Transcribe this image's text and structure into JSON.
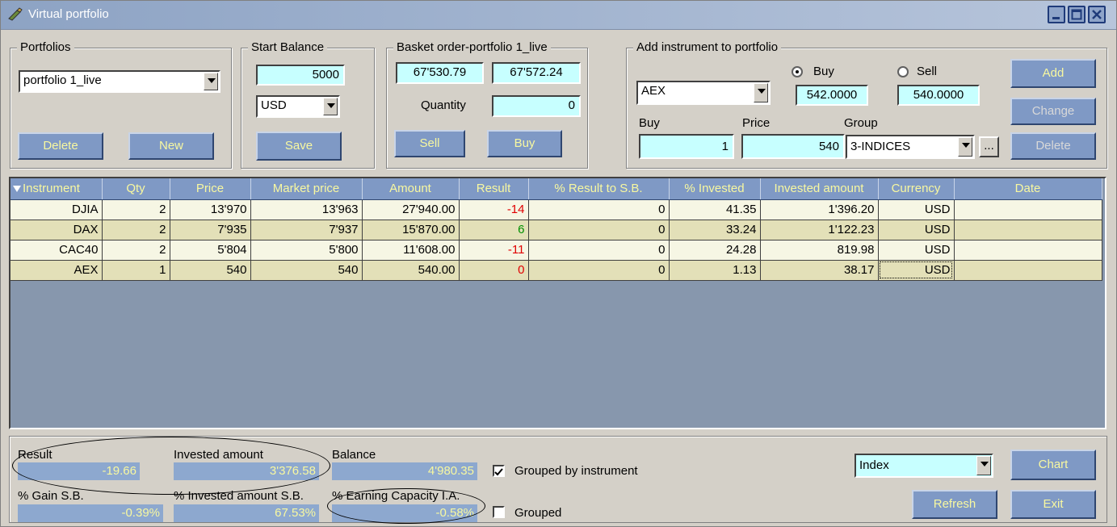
{
  "window": {
    "title": "Virtual portfolio"
  },
  "portfolios": {
    "label": "Portfolios",
    "selected": "portfolio 1_live",
    "delete_label": "Delete",
    "new_label": "New"
  },
  "start_balance": {
    "label": "Start Balance",
    "value": "5000",
    "currency": "USD",
    "save_label": "Save"
  },
  "basket": {
    "label": "Basket order-portfolio 1_live",
    "sell_value": "67'530.79",
    "buy_value": "67'572.24",
    "quantity_label": "Quantity",
    "quantity": "0",
    "sell_label": "Sell",
    "buy_label": "Buy"
  },
  "add_instrument": {
    "label": "Add instrument to portfolio",
    "instrument": "AEX",
    "buy_radio_label": "Buy",
    "sell_radio_label": "Sell",
    "buy_price": "542.0000",
    "sell_price": "540.0000",
    "buy_label": "Buy",
    "price_label": "Price",
    "group_label": "Group",
    "buy_qty": "1",
    "price": "540",
    "group": "3-INDICES",
    "ellipsis": "...",
    "add_label": "Add",
    "change_label": "Change",
    "delete_label": "Delete"
  },
  "table": {
    "columns": [
      "Instrument",
      "Qty",
      "Price",
      "Market price",
      "Amount",
      "Result",
      "% Result to S.B.",
      "% Invested",
      "Invested amount",
      "Currency",
      "Date"
    ],
    "rows": [
      [
        "DJIA",
        "2",
        "13'970",
        "13'963",
        "27'940.00",
        "-14",
        "0",
        "41.35",
        "1'396.20",
        "USD",
        ""
      ],
      [
        "DAX",
        "2",
        "7'935",
        "7'937",
        "15'870.00",
        "6",
        "0",
        "33.24",
        "1'122.23",
        "USD",
        ""
      ],
      [
        "CAC40",
        "2",
        "5'804",
        "5'800",
        "11'608.00",
        "-11",
        "0",
        "24.28",
        "819.98",
        "USD",
        ""
      ],
      [
        "AEX",
        "1",
        "540",
        "540",
        "540.00",
        "0",
        "0",
        "1.13",
        "38.17",
        "USD",
        ""
      ]
    ]
  },
  "summary": {
    "result_label": "Result",
    "result": "-19.66",
    "invested_label": "Invested amount",
    "invested": "3'376.58",
    "balance_label": "Balance",
    "balance": "4'980.35",
    "gain_label": "% Gain S.B.",
    "gain": "-0.39%",
    "invested_sb_label": "% Invested amount S.B.",
    "invested_sb": "67.53%",
    "earning_label": "% Earning Capacity I.A.",
    "earning": "-0.58%",
    "grouped_by_instrument_label": "Grouped by instrument",
    "grouped_label": "Grouped",
    "index_select": "Index",
    "chart_label": "Chart",
    "refresh_label": "Refresh",
    "exit_label": "Exit"
  }
}
